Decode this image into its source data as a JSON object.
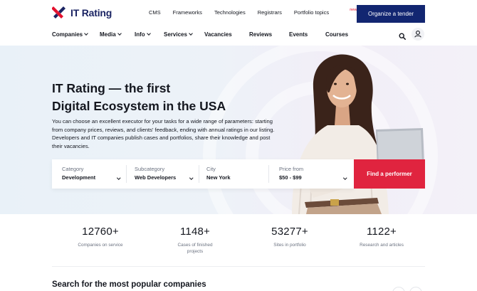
{
  "brand": {
    "name": "IT Rating",
    "colors": {
      "navy": "#1b2463",
      "red": "#e3102d",
      "cta_navy": "#122671",
      "cta_red": "#e0243f"
    }
  },
  "top_links": [
    {
      "label": "CMS"
    },
    {
      "label": "Frameworks"
    },
    {
      "label": "Technologies"
    },
    {
      "label": "Registrars"
    },
    {
      "label": "Portfolio topics",
      "badge": "new"
    }
  ],
  "tender_button": "Organize a tender",
  "nav": [
    {
      "label": "Companies",
      "dropdown": true
    },
    {
      "label": "Media",
      "dropdown": true
    },
    {
      "label": "Info",
      "dropdown": true
    },
    {
      "label": "Services",
      "dropdown": true
    },
    {
      "label": "Vacancies",
      "dropdown": false
    },
    {
      "label": "Reviews",
      "dropdown": false
    },
    {
      "label": "Events",
      "dropdown": false
    },
    {
      "label": "Courses",
      "dropdown": false
    }
  ],
  "icons": {
    "search": "search-icon",
    "account": "user-icon",
    "logo": "logo-mark-icon"
  },
  "hero": {
    "title_line1": "IT Rating — the first",
    "title_line2": "Digital Ecosystem in the USA",
    "description": "You can choose an excellent executor for your tasks for a wide range of parameters: starting from company prices, reviews, and clients' feedback, ending with annual ratings in our listing. Developers and IT companies publish cases and portfolios, share their knowledge and post their vacancies."
  },
  "search_panel": {
    "fields": [
      {
        "label": "Category",
        "value": "Development"
      },
      {
        "label": "Subcategory",
        "value": "Web Developers"
      },
      {
        "label": "City",
        "value": "New York"
      },
      {
        "label": "Price from",
        "value": "$50 - $99"
      }
    ],
    "submit": "Find a performer"
  },
  "stats": [
    {
      "number": "12760+",
      "label": "Companies on service"
    },
    {
      "number": "1148+",
      "label": "Cases of finished projects"
    },
    {
      "number": "53277+",
      "label": "Sites in portfolio"
    },
    {
      "number": "1122+",
      "label": "Research and articles"
    }
  ],
  "popular_section": {
    "title": "Search for the most popular companies"
  }
}
